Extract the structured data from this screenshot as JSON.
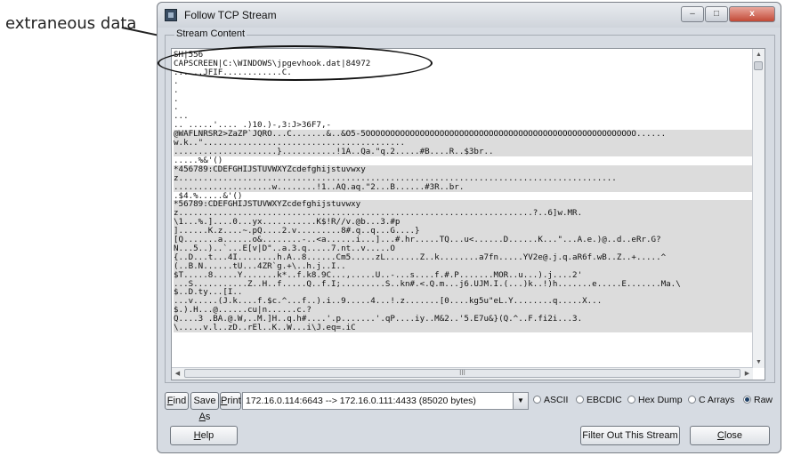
{
  "annotation": {
    "label": "extraneous data"
  },
  "window": {
    "title": "Follow TCP Stream",
    "controls": {
      "minimize": "–",
      "maximize": "□",
      "close": "x"
    }
  },
  "stream_group": {
    "legend": "Stream Content"
  },
  "stream_lines": [
    {
      "text": "SH|556",
      "kind": "client"
    },
    {
      "text": "CAPSCREEN|C:\\WINDOWS\\jpgevhook.dat|84972",
      "kind": "client"
    },
    {
      "text": "......JFIF............C.",
      "kind": "client"
    },
    {
      "text": ".",
      "kind": "client"
    },
    {
      "text": ".",
      "kind": "client"
    },
    {
      "text": ".",
      "kind": "client"
    },
    {
      "text": ".",
      "kind": "client"
    },
    {
      "text": "...",
      "kind": "client"
    },
    {
      "text": ".. .....'.... .)10.)-,3:J>36F7,-",
      "kind": "client"
    },
    {
      "text": "@WAFLNRSR2>ZaZP`JQRO...C.......&..&O5-5OOOOOOOOOOOOOOOOOOOOOOOOOOOOOOOOOOOOOOOOOOOOOOOOOOOOOOO......",
      "kind": "server"
    },
    {
      "text": "w.k..\".........................................",
      "kind": "server"
    },
    {
      "text": ".....................}...........!1A..Qa.\"q.2.....#B....R..$3br..",
      "kind": "server"
    },
    {
      "text": ".....%&'()",
      "kind": "client"
    },
    {
      "text": "*456789:CDEFGHIJSTUVWXYZcdefghijstuvwxy",
      "kind": "server"
    },
    {
      "text": "z.........................................................................................",
      "kind": "server"
    },
    {
      "text": "....................w........!1..AQ.aq.\"2...B......#3R..br.",
      "kind": "server"
    },
    {
      "text": ".$4.%.....&'()",
      "kind": "client"
    },
    {
      "text": "*56789:CDEFGHIJSTUVWXYZcdefghijstuvwxy",
      "kind": "server"
    },
    {
      "text": "z........................................................................?..6]w.MR.",
      "kind": "server"
    },
    {
      "text": "\\1...%.]....0...yx...........K$!R//v.@b...3.#p",
      "kind": "server"
    },
    {
      "text": "]......K.z....~.pQ....2.v.........8#.q..q...G....}",
      "kind": "server"
    },
    {
      "text": "[Q.......a......o&........-..<a......i...]...#.hr.....TQ...u<......D......K...\"...A.e.)@..d..eRr.G?",
      "kind": "server"
    },
    {
      "text": "N...5..)..`...E[v|D\"..a.3.q.....7.nt..v.....O",
      "kind": "server"
    },
    {
      "text": "{..D...t...4I........h.A..8......Cm5.....zL.......Z..k........a7fn.....YV2e@.j.q.aR6f.wB..Z..+.....^",
      "kind": "server"
    },
    {
      "text": "(..B.N......tU...4ZR`g.+\\..h.j..I..",
      "kind": "server"
    },
    {
      "text": "$T.....8.....Y.......k*..f.k8.9C...,.....U..-...s....f.#.P.......MOR..u...).j....2'",
      "kind": "server"
    },
    {
      "text": "...S...........Z..H..f.....Q..f.I;.........S..kn#.<.Q.m...j6.UJM.I.(...)k..!)h.......e.....E.......Ma.\\",
      "kind": "server"
    },
    {
      "text": "$..D.ty...[I..",
      "kind": "server"
    },
    {
      "text": "...v.....(J.k....f.$c.^...f..).i..9.....4...!.z.......[0....kg5u\"eL.Y........q.....X...",
      "kind": "server"
    },
    {
      "text": "$.).H...@......cu|n......c.?",
      "kind": "server"
    },
    {
      "text": "Q....3 .BA.@.W,..M.]H..q.h#....'.p.......'.qP....iy..M&2..'5.E7u&}(Q.^..F.fi2i...3.",
      "kind": "server"
    },
    {
      "text": "\\.....v.l..zD..rEl..K..W...i\\J.eq=.iC",
      "kind": "server"
    }
  ],
  "hscroll": {
    "thumb_label": "III"
  },
  "toolbar": {
    "find": {
      "accel": "F",
      "rest": "ind"
    },
    "save_as": {
      "pre": "Save ",
      "accel": "A",
      "rest": "s"
    },
    "print": {
      "accel": "P",
      "rest": "rint"
    },
    "conversation": "172.16.0.114:6643 --> 172.16.0.111:4433 (85020 bytes)",
    "formats": [
      {
        "label": "ASCII",
        "selected": false
      },
      {
        "label": "EBCDIC",
        "selected": false
      },
      {
        "label": "Hex Dump",
        "selected": false
      },
      {
        "label": "C Arrays",
        "selected": false
      },
      {
        "label": "Raw",
        "selected": true
      }
    ]
  },
  "bottom": {
    "help": {
      "accel": "H",
      "rest": "elp"
    },
    "filter_out": "Filter Out This Stream",
    "close": {
      "accel": "C",
      "rest": "lose"
    }
  }
}
